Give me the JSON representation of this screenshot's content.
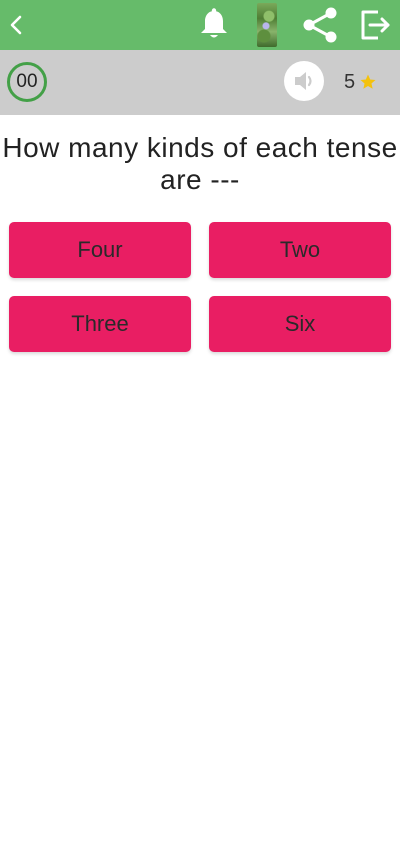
{
  "header": {
    "background": "#66bb6a",
    "icons": [
      "back-icon",
      "bell-icon",
      "photo-icon",
      "share-icon",
      "exit-icon"
    ]
  },
  "status": {
    "timer": "00",
    "score": "5",
    "background": "#cccccc",
    "timer_ring_color": "#43a047",
    "star_color": "#f4c20d"
  },
  "question": {
    "text": "How many kinds of each tense are ---"
  },
  "answers": [
    {
      "label": "Four"
    },
    {
      "label": "Two"
    },
    {
      "label": "Three"
    },
    {
      "label": "Six"
    }
  ],
  "answer_color": "#e91e63"
}
